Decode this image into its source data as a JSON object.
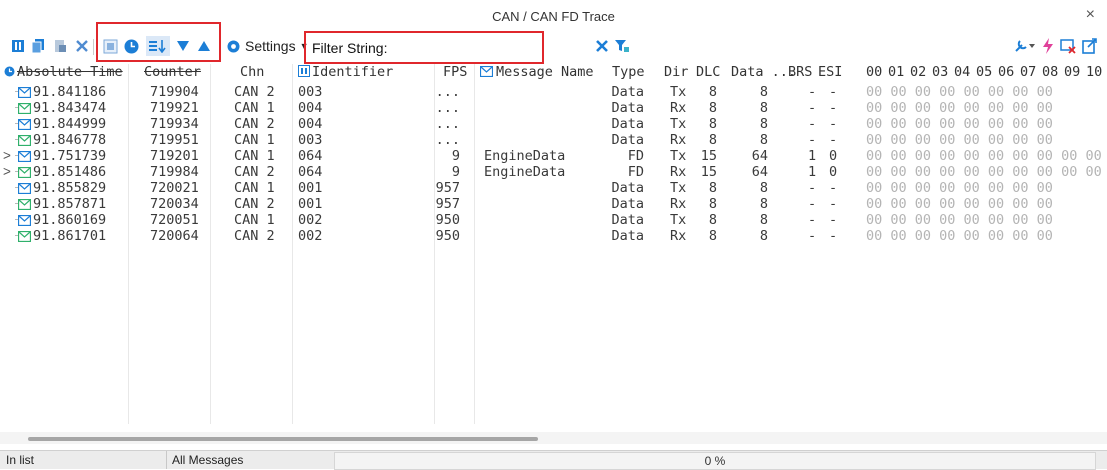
{
  "window": {
    "title": "CAN / CAN FD Trace",
    "close_glyph": "×"
  },
  "toolbar": {
    "settings_label": "Settings",
    "filter_label": "Filter String:",
    "accent_color": "#1c7ed6",
    "highlight_color": "#e0272c"
  },
  "columns": [
    "Absolute Time",
    "Counter",
    "Chn",
    "Identifier",
    "FPS",
    "Message Name",
    "Type",
    "Dir",
    "DLC",
    "Data ...",
    "BRS",
    "ESI",
    "00",
    "01",
    "02",
    "03",
    "04",
    "05",
    "06",
    "07",
    "08",
    "09",
    "10"
  ],
  "rows": [
    {
      "time": "91.841186",
      "counter": "719904",
      "chn": "CAN 2",
      "id": "003",
      "fps": "...",
      "name": "",
      "type": "Data",
      "dir": "Tx",
      "dlc": "8",
      "len": "8",
      "brs": "-",
      "esi": "-",
      "bytes": "00 00 00 00 00 00 00 00",
      "expand": ""
    },
    {
      "time": "91.843474",
      "counter": "719921",
      "chn": "CAN 1",
      "id": "004",
      "fps": "...",
      "name": "",
      "type": "Data",
      "dir": "Rx",
      "dlc": "8",
      "len": "8",
      "brs": "-",
      "esi": "-",
      "bytes": "00 00 00 00 00 00 00 00",
      "expand": ""
    },
    {
      "time": "91.844999",
      "counter": "719934",
      "chn": "CAN 2",
      "id": "004",
      "fps": "...",
      "name": "",
      "type": "Data",
      "dir": "Tx",
      "dlc": "8",
      "len": "8",
      "brs": "-",
      "esi": "-",
      "bytes": "00 00 00 00 00 00 00 00",
      "expand": ""
    },
    {
      "time": "91.846778",
      "counter": "719951",
      "chn": "CAN 1",
      "id": "003",
      "fps": "...",
      "name": "",
      "type": "Data",
      "dir": "Rx",
      "dlc": "8",
      "len": "8",
      "brs": "-",
      "esi": "-",
      "bytes": "00 00 00 00 00 00 00 00",
      "expand": ""
    },
    {
      "time": "91.751739",
      "counter": "719201",
      "chn": "CAN 1",
      "id": "064",
      "fps": "9",
      "name": "EngineData",
      "type": "FD",
      "dir": "Tx",
      "dlc": "15",
      "len": "64",
      "brs": "1",
      "esi": "0",
      "bytes": "00 00 00 00 00 00 00 00 00 00 00",
      "expand": ">"
    },
    {
      "time": "91.851486",
      "counter": "719984",
      "chn": "CAN 2",
      "id": "064",
      "fps": "9",
      "name": "EngineData",
      "type": "FD",
      "dir": "Rx",
      "dlc": "15",
      "len": "64",
      "brs": "1",
      "esi": "0",
      "bytes": "00 00 00 00 00 00 00 00 00 00 00",
      "expand": ">"
    },
    {
      "time": "91.855829",
      "counter": "720021",
      "chn": "CAN 1",
      "id": "001",
      "fps": "957",
      "name": "",
      "type": "Data",
      "dir": "Tx",
      "dlc": "8",
      "len": "8",
      "brs": "-",
      "esi": "-",
      "bytes": "00 00 00 00 00 00 00 00",
      "expand": ""
    },
    {
      "time": "91.857871",
      "counter": "720034",
      "chn": "CAN 2",
      "id": "001",
      "fps": "957",
      "name": "",
      "type": "Data",
      "dir": "Rx",
      "dlc": "8",
      "len": "8",
      "brs": "-",
      "esi": "-",
      "bytes": "00 00 00 00 00 00 00 00",
      "expand": ""
    },
    {
      "time": "91.860169",
      "counter": "720051",
      "chn": "CAN 1",
      "id": "002",
      "fps": "950",
      "name": "",
      "type": "Data",
      "dir": "Tx",
      "dlc": "8",
      "len": "8",
      "brs": "-",
      "esi": "-",
      "bytes": "00 00 00 00 00 00 00 00",
      "expand": ""
    },
    {
      "time": "91.861701",
      "counter": "720064",
      "chn": "CAN 2",
      "id": "002",
      "fps": "950",
      "name": "",
      "type": "Data",
      "dir": "Rx",
      "dlc": "8",
      "len": "8",
      "brs": "-",
      "esi": "-",
      "bytes": "00 00 00 00 00 00 00 00",
      "expand": ""
    }
  ],
  "statusbar": {
    "left": "In list",
    "middle": "All Messages",
    "progress": "0 %",
    "progress_value": 0
  }
}
